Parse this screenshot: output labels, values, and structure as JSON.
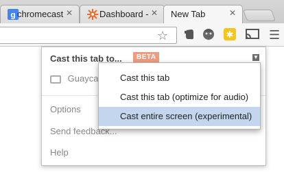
{
  "tabs": [
    {
      "title": "chromecast",
      "icon": "google-g-icon"
    },
    {
      "title": "Dashboard - ",
      "icon": "dashboard-sun-icon"
    },
    {
      "title": "New Tab",
      "icon": ""
    }
  ],
  "toolbar": {
    "star_icon": "star-icon",
    "menu_icon": "hamburger-menu-icon"
  },
  "cast_popup": {
    "header": "Cast this tab to...",
    "badge": "BETA",
    "device": "Guaycas",
    "items": [
      "Options",
      "Send feedback...",
      "Help"
    ]
  },
  "cast_menu": {
    "items": [
      "Cast this tab",
      "Cast this tab (optimize for audio)",
      "Cast entire screen (experimental)"
    ],
    "selected_index": 2
  },
  "colors": {
    "highlight": "#c3d6ee",
    "badge": "#ef9c80",
    "accent_google": "#4285f4"
  }
}
